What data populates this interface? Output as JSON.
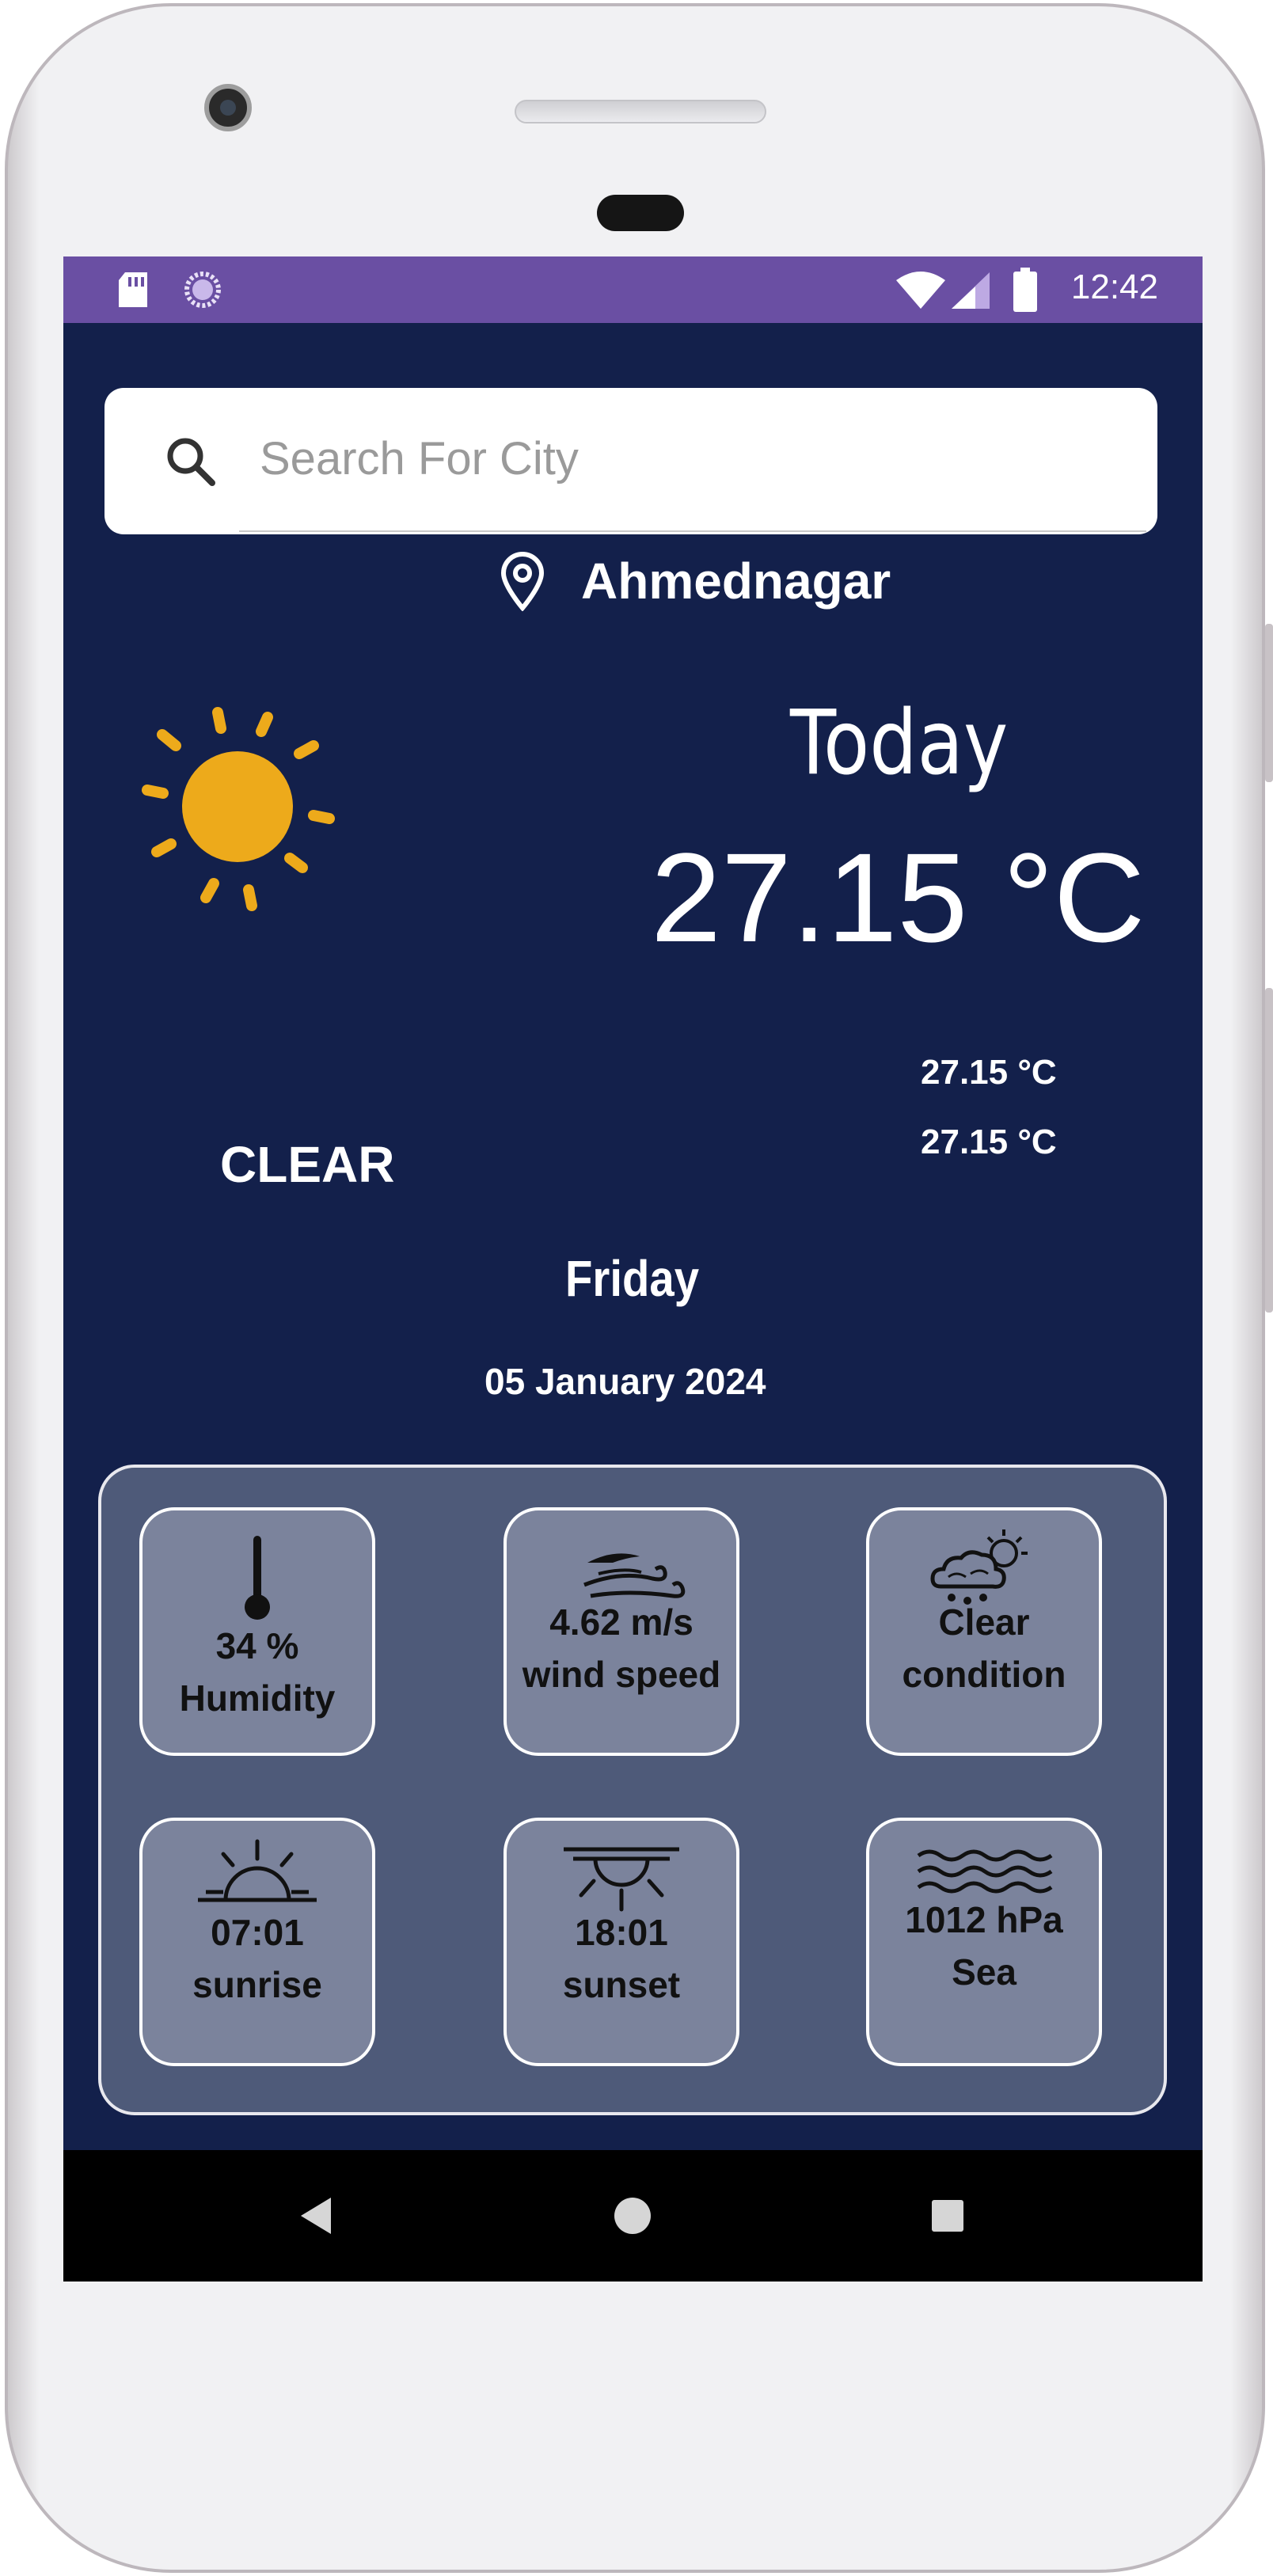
{
  "status_bar": {
    "time": "12:42",
    "icons": [
      "sd-card-icon",
      "sync-icon",
      "wifi-icon",
      "signal-icon",
      "battery-icon"
    ]
  },
  "search": {
    "placeholder": "Search For City"
  },
  "location": {
    "city": "Ahmednagar"
  },
  "weather": {
    "condition": "CLEAR",
    "title": "Today",
    "temperature": "27.15 °C",
    "temp_max": "27.15 °C",
    "temp_min": "27.15 °C",
    "day": "Friday",
    "date": "05 January 2024"
  },
  "details": {
    "humidity": {
      "value": "34 %",
      "label": "Humidity"
    },
    "wind": {
      "value": "4.62 m/s",
      "label": "wind speed"
    },
    "condition": {
      "value": "Clear",
      "label": "condition"
    },
    "sunrise": {
      "value": "07:01",
      "label": "sunrise"
    },
    "sunset": {
      "value": "18:01",
      "label": "sunset"
    },
    "pressure": {
      "value": "1012 hPa",
      "label": "Sea"
    }
  },
  "colors": {
    "background": "#13204b",
    "status_bar": "#6a4fa3",
    "sun": "#edaa1b",
    "panel": "#4e5a79",
    "tile": "#7b839c"
  }
}
